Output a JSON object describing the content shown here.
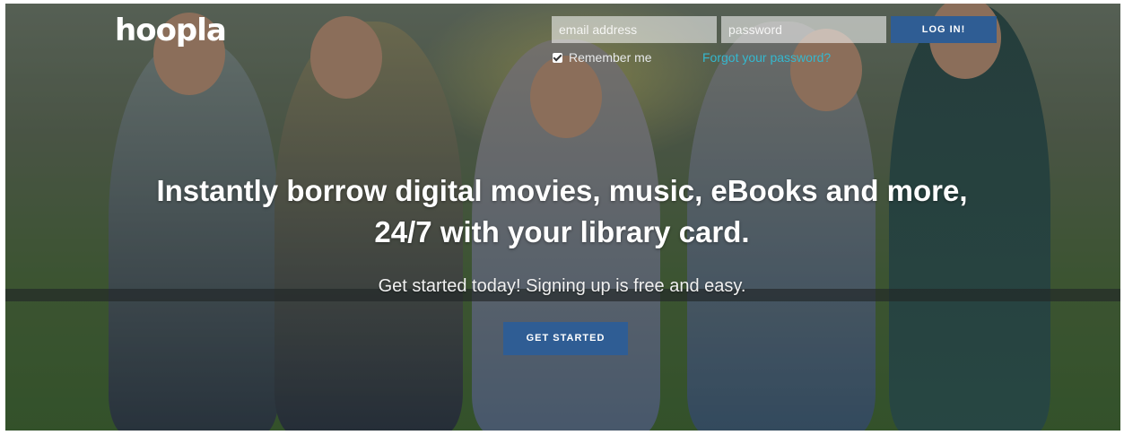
{
  "brand": {
    "logo_text": "hoopla"
  },
  "login": {
    "email_placeholder": "email address",
    "password_placeholder": "password",
    "login_label": "LOG IN!",
    "remember_label": "Remember me",
    "remember_checked": true,
    "forgot_label": "Forgot your password?"
  },
  "hero": {
    "headline_line1": "Instantly borrow digital movies, music, eBooks and more,",
    "headline_line2": "24/7 with your library card.",
    "subline": "Get started today! Signing up is free and easy.",
    "cta_label": "GET STARTED"
  },
  "colors": {
    "button": "#2f5d94",
    "link": "#35b8cf",
    "text": "#ffffff"
  }
}
